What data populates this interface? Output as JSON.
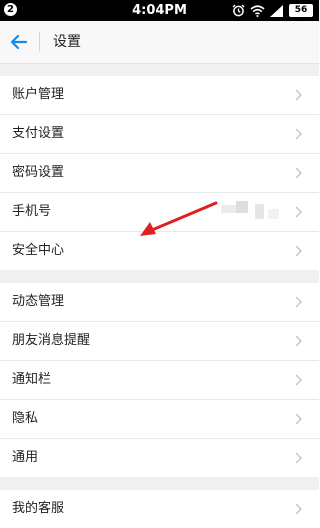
{
  "status_bar": {
    "notification_count": "2",
    "time": "4:04PM",
    "battery": "56",
    "icons": [
      "alarm-icon",
      "wifi-icon",
      "signal-icon",
      "battery-icon"
    ]
  },
  "header": {
    "title": "设置",
    "back_icon": "arrow-left-icon"
  },
  "groups": [
    {
      "items": [
        {
          "label": "账户管理"
        },
        {
          "label": "支付设置"
        },
        {
          "label": "密码设置"
        },
        {
          "label": "手机号",
          "value_obscured": true
        },
        {
          "label": "安全中心"
        }
      ]
    },
    {
      "items": [
        {
          "label": "动态管理"
        },
        {
          "label": "朋友消息提醒"
        },
        {
          "label": "通知栏"
        },
        {
          "label": "隐私"
        },
        {
          "label": "通用"
        }
      ]
    },
    {
      "items": [
        {
          "label": "我的客服"
        }
      ]
    }
  ],
  "annotation": {
    "type": "red-arrow",
    "points_to": "安全中心",
    "color": "#e02020"
  },
  "colors": {
    "accent": "#1e88e5",
    "status_bar": "#000000",
    "background": "#f0f0f0",
    "row_background": "#ffffff",
    "chevron": "#c4c4c4"
  }
}
